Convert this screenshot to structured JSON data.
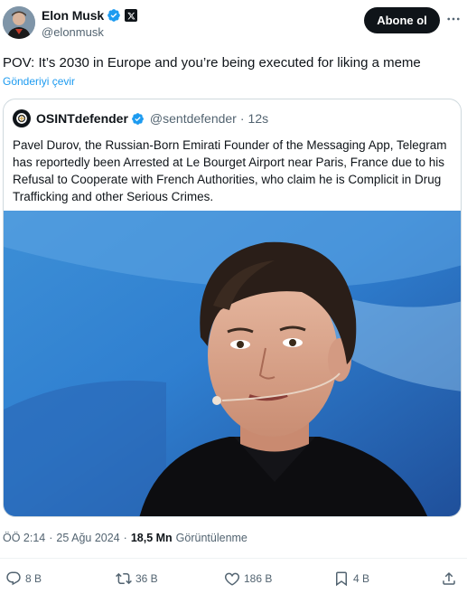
{
  "author": {
    "display_name": "Elon Musk",
    "handle": "@elonmusk",
    "verified": true,
    "affiliate_badge": "x-logo-badge"
  },
  "follow_button": {
    "label": "Abone ol"
  },
  "more_icon": "ellipsis-icon",
  "tweet": {
    "text": "POV: It’s 2030 in Europe and you’re being executed for liking a meme",
    "translate_label": "Gönderiyi çevir"
  },
  "quoted": {
    "display_name": "OSINTdefender",
    "handle": "@sentdefender",
    "separator": "·",
    "time": "12s",
    "verified": true,
    "text": "Pavel Durov, the Russian-Born Emirati Founder of the Messaging App, Telegram has reportedly been Arrested at Le Bourget Airport near Paris, France due to his Refusal to Cooperate with French Authorities, who claim he is Complicit in Drug Trafficking and other Serious Crimes."
  },
  "meta": {
    "time": "ÖÖ 2:14",
    "separator1": "·",
    "date": "25 Ağu 2024",
    "separator2": "·",
    "views_count": "18,5 Mn",
    "views_label": "Görüntülenme"
  },
  "actions": {
    "reply": {
      "icon": "reply-icon",
      "count": "8 B"
    },
    "repost": {
      "icon": "repost-icon",
      "count": "36 B"
    },
    "like": {
      "icon": "heart-icon",
      "count": "186 B"
    },
    "bookmark": {
      "icon": "bookmark-icon",
      "count": "4 B"
    },
    "share": {
      "icon": "share-icon"
    }
  },
  "colors": {
    "accent": "#1d9bf0",
    "text": "#0f1419",
    "secondary": "#536471",
    "border": "#cfd9de"
  }
}
